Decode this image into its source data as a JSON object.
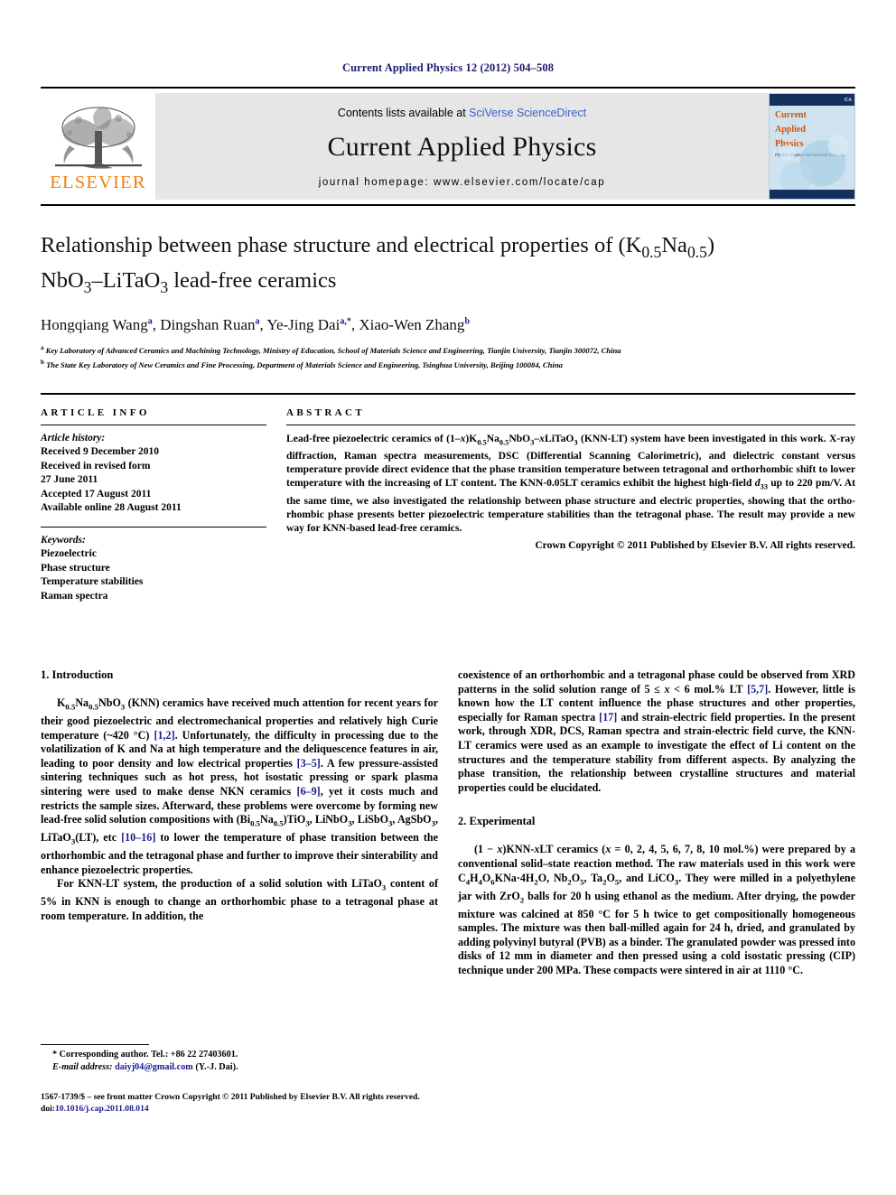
{
  "running_head": "Current Applied Physics 12 (2012) 504–508",
  "masthead": {
    "publisher_name": "ELSEVIER",
    "contents_prefix": "Contents lists available at ",
    "contents_link": "SciVerse ScienceDirect",
    "journal_name": "Current Applied Physics",
    "homepage": "journal homepage: www.elsevier.com/locate/cap",
    "cover": {
      "badge": "ICA",
      "title_line1": "Current",
      "title_line2": "Applied",
      "title_line3": "Physics",
      "subtitle": "Physics, Physical and Materials Sciences"
    }
  },
  "article": {
    "title_line1": "Relationship between phase structure and electrical properties of (K",
    "title_sub1": "0.5",
    "title_mid": "Na",
    "title_sub2": "0.5",
    "title_close": ")",
    "title_line2_a": "NbO",
    "title_line2_sub": "3",
    "title_line2_b": "–LiTaO",
    "title_line2_sub2": "3",
    "title_line2_c": " lead-free ceramics",
    "authors": "Hongqiang Wang a, Dingshan Ruan a, Ye-Jing Dai a,*, Xiao-Wen Zhang b",
    "affiliation_a": "Key Laboratory of Advanced Ceramics and Machining Technology, Ministry of Education, School of Materials Science and Engineering, Tianjin University, Tianjin 300072, China",
    "affiliation_b": "The State Key Laboratory of New Ceramics and Fine Processing, Department of Materials Science and Engineering, Tsinghua University, Beijing 100084, China"
  },
  "article_info": {
    "heading": "ARTICLE INFO",
    "history_label": "Article history:",
    "history": [
      "Received 9 December 2010",
      "Received in revised form",
      "27 June 2011",
      "Accepted 17 August 2011",
      "Available online 28 August 2011"
    ],
    "keywords_label": "Keywords:",
    "keywords": [
      "Piezoelectric",
      "Phase structure",
      "Temperature stabilities",
      "Raman spectra"
    ]
  },
  "abstract": {
    "heading": "ABSTRACT",
    "text": "Lead-free piezoelectric ceramics of (1−x)K0.5Na0.5NbO3–xLiTaO3 (KNN-LT) system have been investigated in this work. X-ray diffraction, Raman spectra measurements, DSC (Differential Scanning Calorimetric), and dielectric constant versus temperature provide direct evidence that the phase transition temperature between tetragonal and orthorhombic shift to lower temperature with the increasing of LT content. The KNN-0.05LT ceramics exhibit the highest high-field d33 up to 220 pm/V. At the same time, we also investigated the relationship between phase structure and electric properties, showing that the ortho-rhombic phase presents better piezoelectric temperature stabilities than the tetragonal phase. The result may provide a new way for KNN-based lead-free ceramics.",
    "copyright": "Crown Copyright © 2011 Published by Elsevier B.V. All rights reserved."
  },
  "sections": {
    "introduction_heading": "1. Introduction",
    "intro_p1": "K0.5Na0.5NbO3 (KNN) ceramics have received much attention for recent years for their good piezoelectric and electromechanical properties and relatively high Curie temperature (~420 °C) [1,2]. Unfortunately, the difficulty in processing due to the volatilization of K and Na at high temperature and the deliquescence features in air, leading to poor density and low electrical properties [3–5]. A few pressure-assisted sintering techniques such as hot press, hot isostatic pressing or spark plasma sintering were used to make dense NKN ceramics [6–9], yet it costs much and restricts the sample sizes. Afterward, these problems were overcome by forming new lead-free solid solution compositions with (Bi0.5Na0.5)TiO3, LiNbO3, LiSbO3, AgSbO3, LiTaO3(LT), etc [10–16] to lower the temperature of phase transition between the orthorhombic and the tetragonal phase and further to improve their sinterability and enhance piezoelectric properties.",
    "intro_p2": "For KNN-LT system, the production of a solid solution with LiTaO3 content of 5% in KNN is enough to change an orthorhombic phase to a tetragonal phase at room temperature. In addition, the",
    "intro_p3": "coexistence of an orthorhombic and a tetragonal phase could be observed from XRD patterns in the solid solution range of 5 ≤ x < 6 mol.% LT [5,7]. However, little is known how the LT content influence the phase structures and other properties, especially for Raman spectra [17] and strain-electric field properties. In the present work, through XDR, DCS, Raman spectra and strain-electric field curve, the KNN-LT ceramics were used as an example to investigate the effect of Li content on the structures and the temperature stability from different aspects. By analyzing the phase transition, the relationship between crystalline structures and material properties could be elucidated.",
    "experimental_heading": "2. Experimental",
    "exp_p1": "(1 − x)KNN-xLT ceramics (x = 0, 2, 4, 5, 6, 7, 8, 10 mol.%) were prepared by a conventional solid–state reaction method. The raw materials used in this work were C4H4O6KNa·4H2O, Nb2O5, Ta2O5, and LiCO3. They were milled in a polyethylene jar with ZrO2 balls for 20 h using ethanol as the medium. After drying, the powder mixture was calcined at 850 °C for 5 h twice to get compositionally homogeneous samples. The mixture was then ball-milled again for 24 h, dried, and granulated by adding polyvinyl butyral (PVB) as a binder. The granulated powder was pressed into disks of 12 mm in diameter and then pressed using a cold isostatic pressing (CIP) technique under 200 MPa. These compacts were sintered in air at 1110 °C."
  },
  "footnote": {
    "corresponding": "* Corresponding author. Tel.: +86 22 27403601.",
    "email_label": "E-mail address: ",
    "email": "daiyj04@gmail.com",
    "email_suffix": " (Y.-J. Dai)."
  },
  "colophon": {
    "line1": "1567-1739/$ – see front matter Crown Copyright © 2011 Published by Elsevier B.V. All rights reserved.",
    "doi_label": "doi:",
    "doi": "10.1016/j.cap.2011.08.014"
  },
  "colors": {
    "running_head": "#1b1b6f",
    "link": "#3a5fcd",
    "elsevier_orange": "#f07d10",
    "reference": "#1b1b8f",
    "banner_bg": "#e6e6e6"
  }
}
